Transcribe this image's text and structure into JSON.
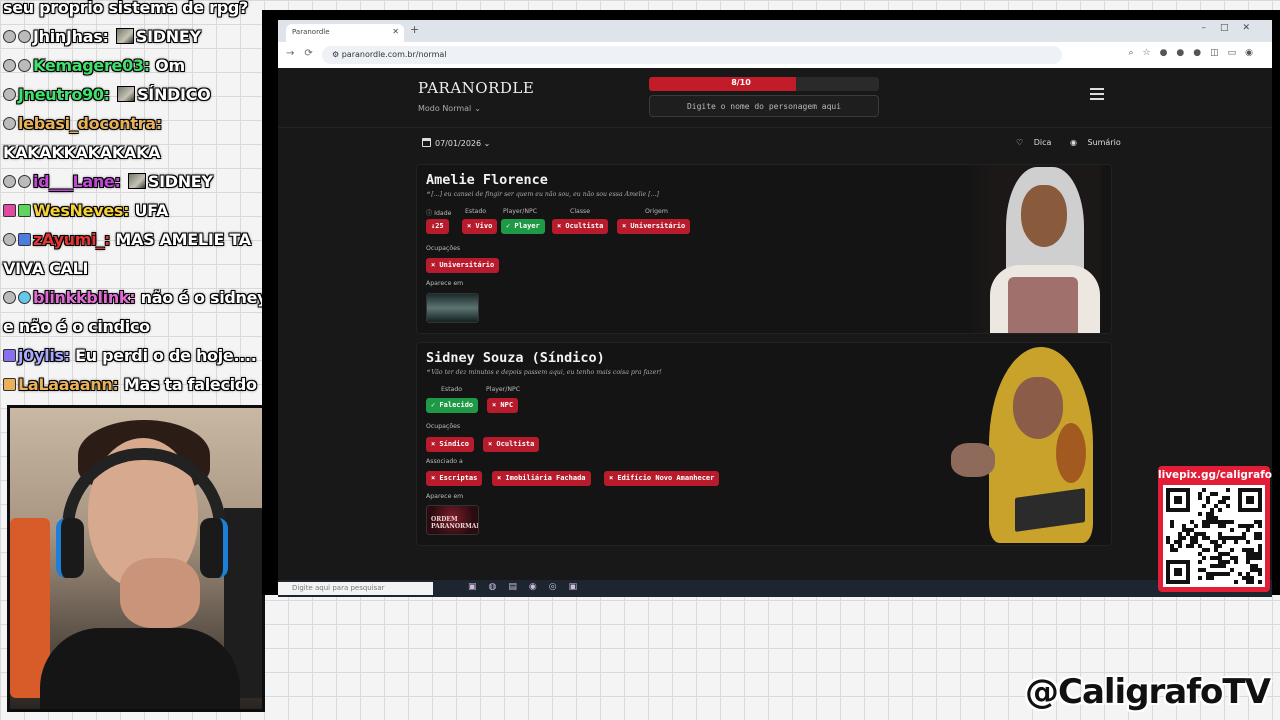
{
  "chat": {
    "messages": [
      {
        "user": "",
        "text": "seu proprio sistema de rpg?",
        "color": "#ffffff"
      },
      {
        "user": "JhinJhas:",
        "text": "SIDNEY",
        "color": "#ffffff"
      },
      {
        "user": "Kemagere03:",
        "text": "Om",
        "color": "#3fe26a"
      },
      {
        "user": "Jneutro90:",
        "text": "SÍNDICO",
        "color": "#3fe26a"
      },
      {
        "user": "lebasi_docontra:",
        "text": "",
        "color": "#e9b25a"
      },
      {
        "user": "",
        "text": "KAKAKKAKAKAKA",
        "color": "#ffffff"
      },
      {
        "user": "id___Lane:",
        "text": "SIDNEY",
        "color": "#c147d6"
      },
      {
        "user": "WesNeves:",
        "text": "UFA",
        "color": "#f5d13a"
      },
      {
        "user": "zAyumi_:",
        "text": "MAS AMELIE TA",
        "color": "#e53434"
      },
      {
        "user": "",
        "text": "VIVA CALI",
        "color": "#ffffff"
      },
      {
        "user": "blinkkblink:",
        "text": "não é o sidney,",
        "color": "#e36ad6"
      },
      {
        "user": "",
        "text": "e não é o cindico",
        "color": "#ffffff"
      },
      {
        "user": "j0ylis:",
        "text": "Eu perdi o de hoje....",
        "color": "#a8a8ff"
      },
      {
        "user": "LaLaaaann:",
        "text": "Mas ta falecido",
        "color": "#e9b25a"
      }
    ]
  },
  "browser": {
    "tab_title": "Paranordle",
    "url": "paranordle.com.br/normal",
    "taskbar_search": "Digite aqui para pesquisar"
  },
  "app": {
    "logo": "PARANORDLE",
    "mode": "Modo Normal",
    "progress_label": "8/10",
    "progress_fraction": 0.8,
    "search_placeholder": "Digite o nome do personagem aqui",
    "date": "07/01/2026",
    "hint_label": "Dica",
    "summary_label": "Sumário"
  },
  "cards": [
    {
      "name": "Amelie Florence",
      "quote": "❝ [...] eu cansei de fingir ser quem eu não sou, eu não sou essa Amelie [...]",
      "labels": {
        "age": "Idade",
        "state": "Estado",
        "player": "Player/NPC",
        "class": "Classe",
        "origin": "Origem",
        "occupations": "Ocupações",
        "appears": "Aparece em"
      },
      "chips": {
        "age": "↓25",
        "state": "× Vivo",
        "player": "✓ Player",
        "class": "× Ocultista",
        "origin": "× Universitário"
      },
      "occupations": [
        "× Universitário"
      ]
    },
    {
      "name": "Sidney Souza (Síndico)",
      "quote": "❝ Vão ter dez minutos e depois passem aqui, eu tenho mais coisa pra fazer!",
      "labels": {
        "state": "Estado",
        "player": "Player/NPC",
        "occupations": "Ocupações",
        "associated": "Associado a",
        "appears": "Aparece em"
      },
      "chips": {
        "state": "✓ Falecido",
        "player": "× NPC"
      },
      "occupations": [
        "× Síndico",
        "× Ocultista"
      ],
      "associated": [
        "× Escriptas",
        "× Imobiliária Fachada",
        "× Edifício Novo Amanhecer"
      ],
      "thumb_text": "ORDEM PARANORMAL"
    }
  ],
  "donation": {
    "title": "livepix.gg/caligrafo"
  },
  "handle": "@CaligrafoTV",
  "colors": {
    "red": "#b81c2c",
    "green": "#1e9a46",
    "page_bg": "#181818"
  }
}
